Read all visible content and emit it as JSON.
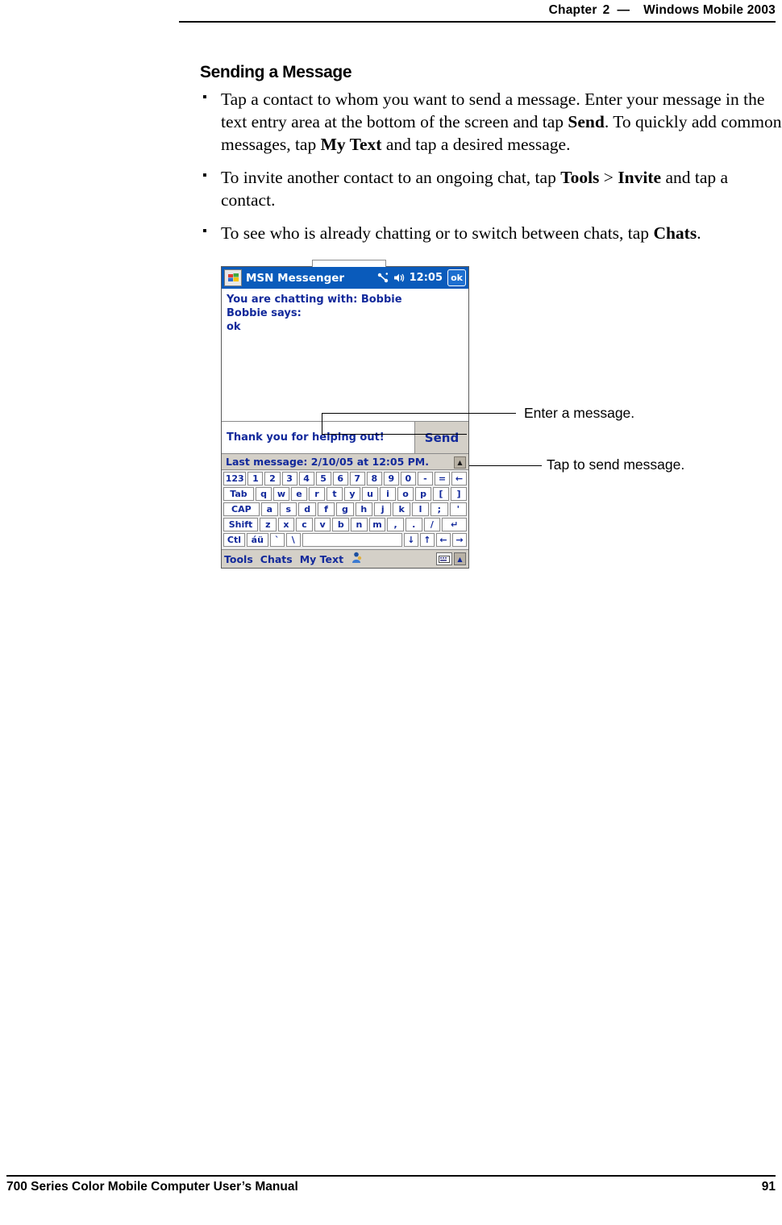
{
  "header": {
    "chapter_word": "Chapter",
    "chapter_num": "2",
    "dash": "—",
    "product": "Windows Mobile 2003"
  },
  "section": {
    "title": "Sending a Message",
    "bullets": [
      {
        "parts": [
          {
            "t": "Tap a contact to whom you want to send a message. Enter your message in the text entry area at the bottom of the screen and tap ",
            "b": false
          },
          {
            "t": "Send",
            "b": true
          },
          {
            "t": ". To quickly add common messages, tap ",
            "b": false
          },
          {
            "t": "My Text",
            "b": true
          },
          {
            "t": " and tap a desired message.",
            "b": false
          }
        ]
      },
      {
        "parts": [
          {
            "t": "To invite another contact to an ongoing chat, tap ",
            "b": false
          },
          {
            "t": "Tools",
            "b": true
          },
          {
            "t": " > ",
            "b": false
          },
          {
            "t": "Invite",
            "b": true
          },
          {
            "t": " and tap a contact.",
            "b": false
          }
        ]
      },
      {
        "parts": [
          {
            "t": "To see who is already chatting or to switch between chats, tap ",
            "b": false
          },
          {
            "t": "Chats",
            "b": true
          },
          {
            "t": ".",
            "b": false
          }
        ]
      }
    ]
  },
  "device": {
    "titlebar": {
      "start_icon": "windows-flag-icon",
      "title": "MSN Messenger",
      "connectivity_icon": "connectivity-icon",
      "volume_icon": "speaker-icon",
      "clock": "12:05",
      "ok_label": "ok"
    },
    "chat": {
      "chatting_with": "You are chatting with: Bobbie",
      "sender_line": "Bobbie says:",
      "message": "ok"
    },
    "entry": {
      "value": "Thank you for helping out!",
      "send_label": "Send"
    },
    "status": "Last message: 2/10/05 at 12:05 PM.",
    "keyboard": {
      "row1": [
        "123",
        "1",
        "2",
        "3",
        "4",
        "5",
        "6",
        "7",
        "8",
        "9",
        "0",
        "-",
        "=",
        "←"
      ],
      "row2": [
        "Tab",
        "q",
        "w",
        "e",
        "r",
        "t",
        "y",
        "u",
        "i",
        "o",
        "p",
        "[",
        "]"
      ],
      "row3": [
        "CAP",
        "a",
        "s",
        "d",
        "f",
        "g",
        "h",
        "j",
        "k",
        "l",
        ";",
        "'"
      ],
      "row4": [
        "Shift",
        "z",
        "x",
        "c",
        "v",
        "b",
        "n",
        "m",
        ",",
        ".",
        "/",
        "↵"
      ],
      "row5": [
        "Ctl",
        "áü",
        "`",
        "\\",
        "",
        "↓",
        "↑",
        "←",
        "→"
      ]
    },
    "cmdbar": {
      "items": [
        "Tools",
        "Chats",
        "My Text"
      ],
      "person_icon": "contact-icon",
      "keyboard_icon": "keyboard-icon",
      "up_icon": "caret-up-icon"
    }
  },
  "callouts": {
    "enter_message": "Enter a message.",
    "tap_to_send": "Tap to send message."
  },
  "footer": {
    "manual_title": "700 Series Color Mobile Computer User’s Manual",
    "page_number": "91"
  }
}
